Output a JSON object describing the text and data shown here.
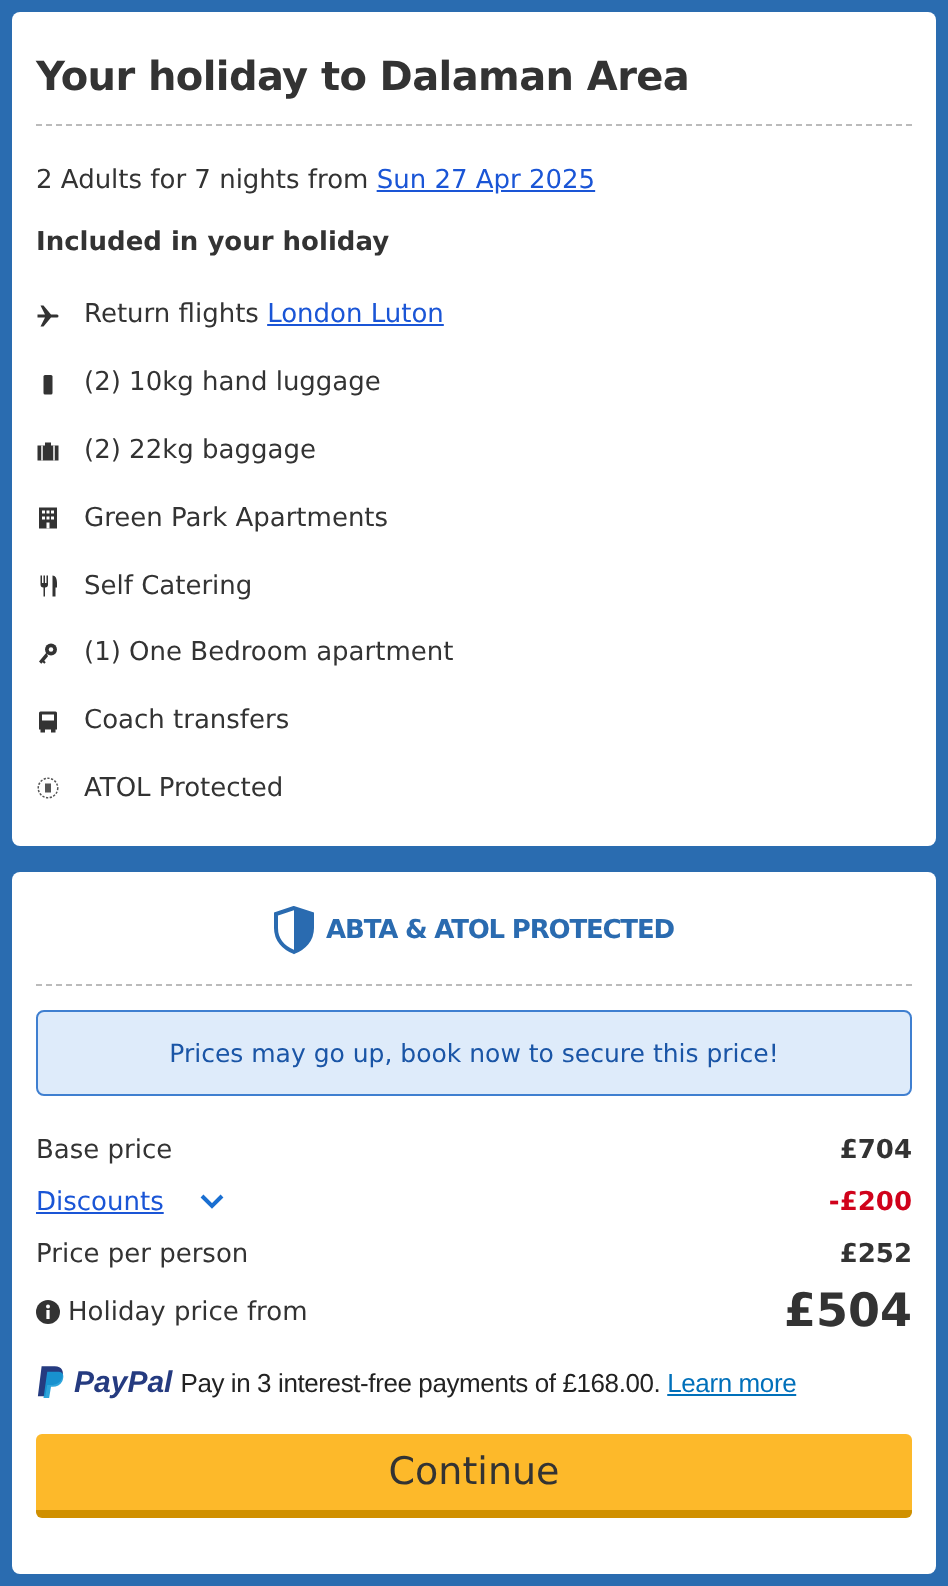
{
  "summary": {
    "title": "Your holiday to Dalaman Area",
    "intro": "2 Adults for 7 nights from",
    "date_link": "Sun 27 Apr 2025",
    "included_heading": "Included in your holiday",
    "items": [
      {
        "kind": "flight",
        "text": "Return flights",
        "link": "London Luton"
      },
      {
        "kind": "hand-luggage",
        "text": "(2) 10kg hand luggage"
      },
      {
        "kind": "baggage",
        "text": "(2) 22kg baggage"
      },
      {
        "kind": "hotel",
        "text": "Green Park Apartments"
      },
      {
        "kind": "board",
        "text": "Self Catering"
      },
      {
        "kind": "room",
        "text": "(1) One Bedroom apartment"
      },
      {
        "kind": "transfer",
        "text": "Coach transfers"
      },
      {
        "kind": "atol",
        "text": "ATOL Protected"
      }
    ]
  },
  "pricing": {
    "protection_badge": "ABTA & ATOL PROTECTED",
    "notice": "Prices may go up, book now to secure this price!",
    "rows": [
      {
        "kind": "plain",
        "label": "Base price",
        "value": "£704"
      },
      {
        "kind": "discount",
        "label": "Discounts",
        "value": "-£200",
        "expanded": false
      },
      {
        "kind": "plain",
        "label": "Price per person",
        "value": "£252"
      },
      {
        "kind": "total",
        "label": "Holiday price from",
        "value": "£504"
      }
    ],
    "paypal": {
      "logo": "PayPal",
      "text": "Pay in 3 interest-free payments of £168.00.",
      "link": "Learn more"
    },
    "button": "Continue"
  }
}
